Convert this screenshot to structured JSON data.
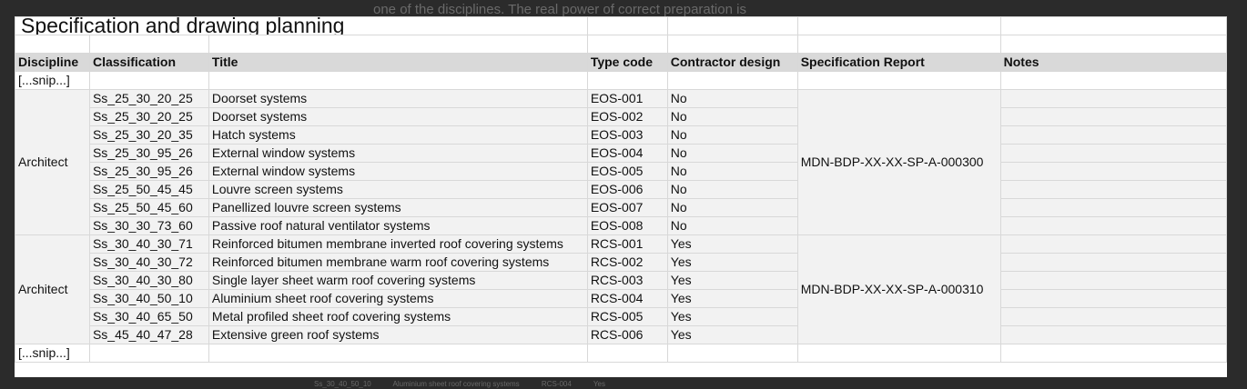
{
  "background_text": {
    "top": "one of the disciplines. The real power of correct preparation is",
    "bottom_code": "Ss_30_40_50_10",
    "bottom_title": "Aluminium sheet roof covering systems",
    "bottom_type": "RCS-004",
    "bottom_yes": "Yes"
  },
  "sheet": {
    "title": "Specification and drawing planning",
    "headers": [
      "Discipline",
      "Classification",
      "Title",
      "Type code",
      "Contractor design",
      "Specification Report",
      "Notes"
    ],
    "snip_label": "[...snip...]"
  },
  "groups": [
    {
      "discipline": "Architect",
      "report": "MDN-BDP-XX-XX-SP-A-000300",
      "rows": [
        {
          "classification": "Ss_25_30_20_25",
          "title": "Doorset systems",
          "type_code": "EOS-001",
          "contractor_design": "No"
        },
        {
          "classification": "Ss_25_30_20_25",
          "title": "Doorset systems",
          "type_code": "EOS-002",
          "contractor_design": "No"
        },
        {
          "classification": "Ss_25_30_20_35",
          "title": "Hatch systems",
          "type_code": "EOS-003",
          "contractor_design": "No"
        },
        {
          "classification": "Ss_25_30_95_26",
          "title": "External window systems",
          "type_code": "EOS-004",
          "contractor_design": "No"
        },
        {
          "classification": "Ss_25_30_95_26",
          "title": "External window systems",
          "type_code": "EOS-005",
          "contractor_design": "No"
        },
        {
          "classification": "Ss_25_50_45_45",
          "title": "Louvre screen systems",
          "type_code": "EOS-006",
          "contractor_design": "No"
        },
        {
          "classification": "Ss_25_50_45_60",
          "title": "Panellized louvre screen systems",
          "type_code": "EOS-007",
          "contractor_design": "No"
        },
        {
          "classification": "Ss_30_30_73_60",
          "title": "Passive roof natural ventilator systems",
          "type_code": "EOS-008",
          "contractor_design": "No"
        }
      ]
    },
    {
      "discipline": "Architect",
      "report": "MDN-BDP-XX-XX-SP-A-000310",
      "rows": [
        {
          "classification": "Ss_30_40_30_71",
          "title": "Reinforced bitumen membrane inverted roof covering systems",
          "type_code": "RCS-001",
          "contractor_design": "Yes"
        },
        {
          "classification": "Ss_30_40_30_72",
          "title": "Reinforced bitumen membrane warm roof covering systems",
          "type_code": "RCS-002",
          "contractor_design": "Yes"
        },
        {
          "classification": "Ss_30_40_30_80",
          "title": "Single layer sheet warm roof covering systems",
          "type_code": "RCS-003",
          "contractor_design": "Yes"
        },
        {
          "classification": "Ss_30_40_50_10",
          "title": "Aluminium sheet roof covering systems",
          "type_code": "RCS-004",
          "contractor_design": "Yes"
        },
        {
          "classification": "Ss_30_40_65_50",
          "title": "Metal profiled sheet roof covering systems",
          "type_code": "RCS-005",
          "contractor_design": "Yes"
        },
        {
          "classification": "Ss_45_40_47_28",
          "title": "Extensive green roof systems",
          "type_code": "RCS-006",
          "contractor_design": "Yes"
        }
      ]
    }
  ]
}
